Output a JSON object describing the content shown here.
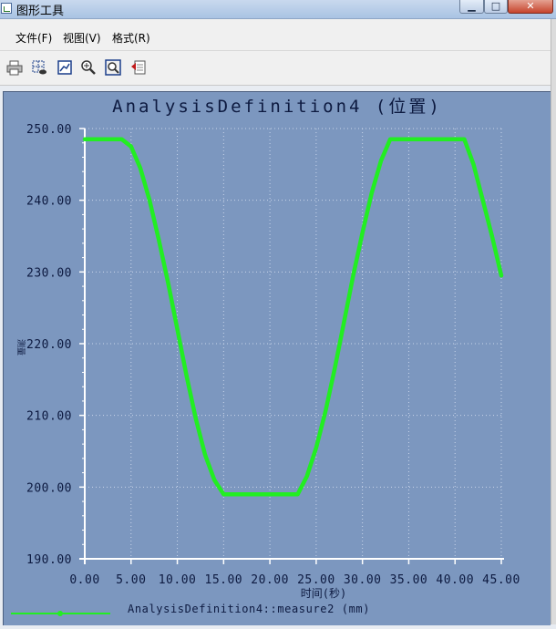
{
  "window": {
    "title": "图形工具",
    "minimize_symbol": "▁",
    "maximize_symbol": "□",
    "close_symbol": "✕"
  },
  "menu": [
    {
      "label": "文件(F)"
    },
    {
      "label": "视图(V)"
    },
    {
      "label": "格式(R)"
    }
  ],
  "toolbar": {
    "buttons": [
      "print-icon",
      "grid-select-icon",
      "chart-edit-icon",
      "zoom-in-icon",
      "zoom-fit-icon",
      "export-icon"
    ]
  },
  "colors": {
    "plot_background": "#7c97bf",
    "series": "#22ee22",
    "axis": "#ffffff",
    "text": "#0d1a40"
  },
  "chart_data": {
    "type": "line",
    "title": "AnalysisDefinition4 (位置)",
    "xlabel": "时间(秒)",
    "ylabel": "测量",
    "xlim": [
      0,
      45
    ],
    "ylim": [
      190,
      250
    ],
    "x_ticks": [
      "0.00",
      "5.00",
      "10.00",
      "15.00",
      "20.00",
      "25.00",
      "30.00",
      "35.00",
      "40.00",
      "45.00"
    ],
    "y_ticks": [
      "250.00",
      "240.00",
      "230.00",
      "220.00",
      "210.00",
      "200.00",
      "190.00"
    ],
    "grid": true,
    "legend_position": "bottom-left",
    "series": [
      {
        "name": "AnalysisDefinition4::measure2 (mm)",
        "x": [
          0,
          1,
          2,
          3,
          4,
          5,
          6,
          7,
          8,
          9,
          10,
          11,
          12,
          13,
          14,
          15,
          16,
          17,
          18,
          19,
          20,
          21,
          22,
          23,
          24,
          25,
          26,
          27,
          28,
          29,
          30,
          31,
          32,
          33,
          34,
          35,
          36,
          37,
          38,
          39,
          40,
          41,
          42,
          43,
          44,
          45
        ],
        "y": [
          248.5,
          248.5,
          248.5,
          248.5,
          248.5,
          247.5,
          244.5,
          240,
          234.5,
          228.5,
          222,
          215.5,
          209.5,
          204.5,
          201,
          199,
          199,
          199,
          199,
          199,
          199,
          199,
          199,
          199,
          201.5,
          205.5,
          210.5,
          216.5,
          223,
          229.5,
          235.5,
          241,
          245.5,
          248.5,
          248.5,
          248.5,
          248.5,
          248.5,
          248.5,
          248.5,
          248.5,
          248.5,
          245,
          240,
          235,
          229.5
        ]
      }
    ]
  }
}
